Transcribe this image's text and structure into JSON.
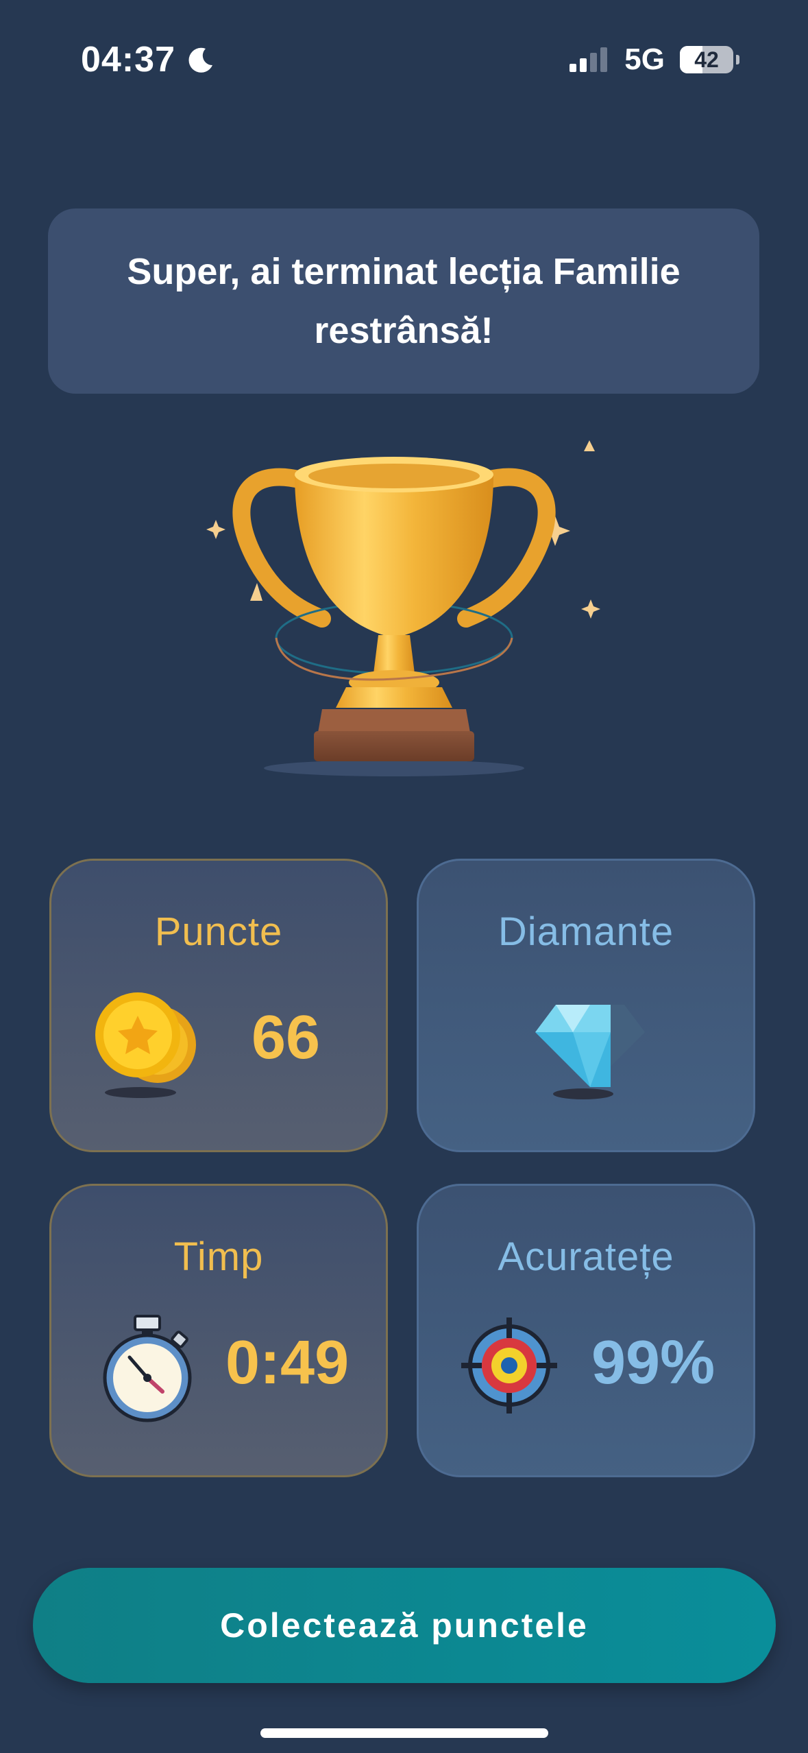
{
  "status_bar": {
    "time": "04:37",
    "moon_icon": "moon-icon",
    "signal_icon": "cellular-signal-icon",
    "network": "5G",
    "battery": "42",
    "battery_level": 0.42
  },
  "header": {
    "message": "Super, ai terminat lecția Familie restrânsă!"
  },
  "trophy_icon": "trophy-icon",
  "stats": {
    "points": {
      "label": "Puncte",
      "value": "66",
      "icon": "coins-icon"
    },
    "diamonds": {
      "label": "Diamante",
      "icon": "diamond-icon"
    },
    "time": {
      "label": "Timp",
      "value": "0:49",
      "icon": "stopwatch-icon"
    },
    "accuracy": {
      "label": "Acuratețe",
      "value": "99%",
      "icon": "target-icon"
    }
  },
  "actions": {
    "collect_label": "Colectează punctele"
  },
  "colors": {
    "background": "#263852",
    "card": "#3c4f6f",
    "gold": "#f7c24d",
    "blue": "#86bde6",
    "button": "#0a8e9a"
  }
}
